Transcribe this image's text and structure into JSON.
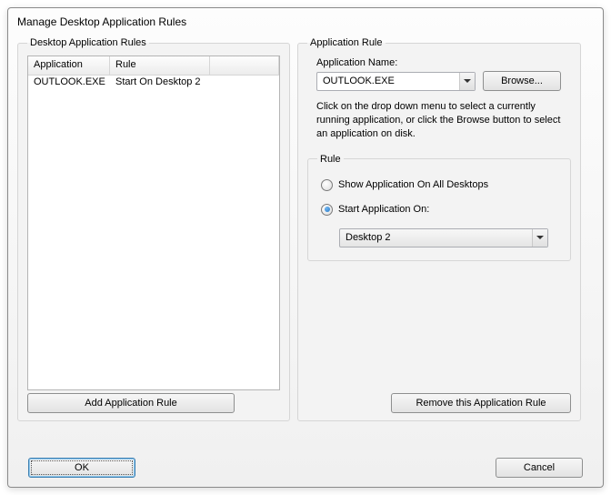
{
  "window": {
    "title": "Manage Desktop Application Rules"
  },
  "left": {
    "legend": "Desktop Application Rules",
    "columns": {
      "app": "Application",
      "rule": "Rule"
    },
    "rows": [
      {
        "app": "OUTLOOK.EXE",
        "rule": "Start On Desktop 2"
      }
    ],
    "add_label": "Add Application Rule"
  },
  "right": {
    "legend": "Application Rule",
    "appname_label": "Application Name:",
    "appname_value": "OUTLOOK.EXE",
    "browse_label": "Browse...",
    "hint": "Click on the drop down menu to select a currently running application, or click the Browse button to select an application on disk.",
    "rule_legend": "Rule",
    "radio_all": "Show Application On All Desktops",
    "radio_start": "Start Application On:",
    "desktop_value": "Desktop 2",
    "remove_label": "Remove this Application Rule"
  },
  "footer": {
    "ok": "OK",
    "cancel": "Cancel"
  }
}
